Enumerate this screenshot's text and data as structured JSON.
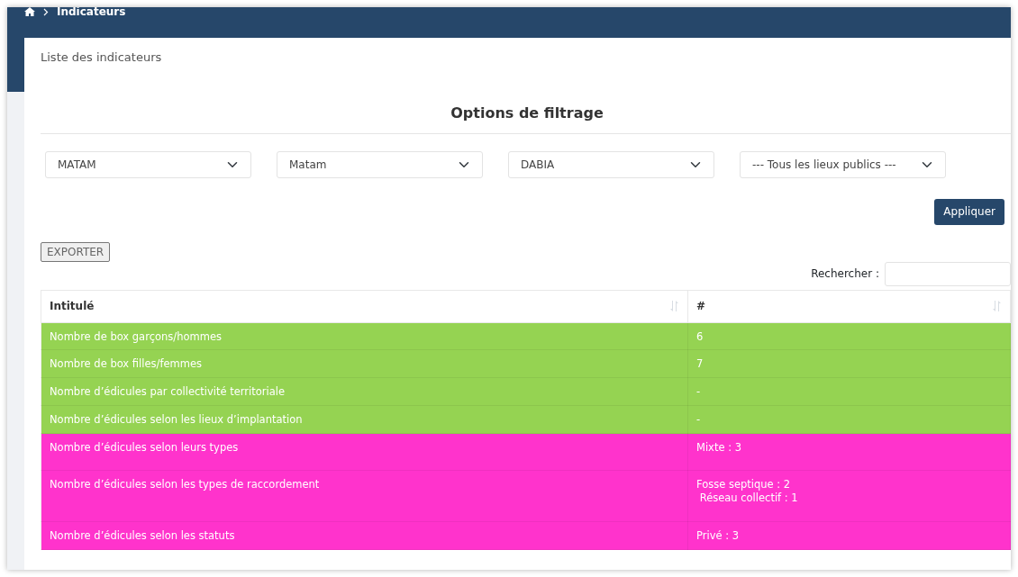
{
  "breadcrumb": {
    "current": "Indicateurs"
  },
  "card": {
    "title": "Liste des indicateurs"
  },
  "filters": {
    "title": "Options de filtrage",
    "selects": [
      {
        "value": "MATAM"
      },
      {
        "value": "Matam"
      },
      {
        "value": "DABIA"
      },
      {
        "value": "--- Tous les lieux publics ---"
      }
    ],
    "apply_button": "Appliquer"
  },
  "export_button": "EXPORTER",
  "search": {
    "label": "Rechercher :"
  },
  "table": {
    "columns": [
      "Intitulé",
      "#"
    ],
    "rows": [
      {
        "label": "Nombre de box garçons/hommes",
        "value": [
          "6"
        ],
        "color": "#95d352"
      },
      {
        "label": "Nombre de box filles/femmes",
        "value": [
          "7"
        ],
        "color": "#95d352"
      },
      {
        "label": "Nombre d’édicules par collectivité territoriale",
        "value": [
          "-"
        ],
        "color": "#95d352"
      },
      {
        "label": "Nombre d’édicules selon les lieux d’implantation",
        "value": [
          "-"
        ],
        "color": "#95d352"
      },
      {
        "label": "Nombre d’édicules selon leurs types",
        "value": [
          "Mixte : 3"
        ],
        "color": "#ff33cc"
      },
      {
        "label": "Nombre d’édicules selon les types de raccordement",
        "value": [
          "Fosse septique : 2",
          " Réseau collectif : 1"
        ],
        "color": "#ff33cc"
      },
      {
        "label": "Nombre d’édicules selon les statuts",
        "value": [
          "Privé : 3"
        ],
        "color": "#ff33cc"
      }
    ]
  }
}
